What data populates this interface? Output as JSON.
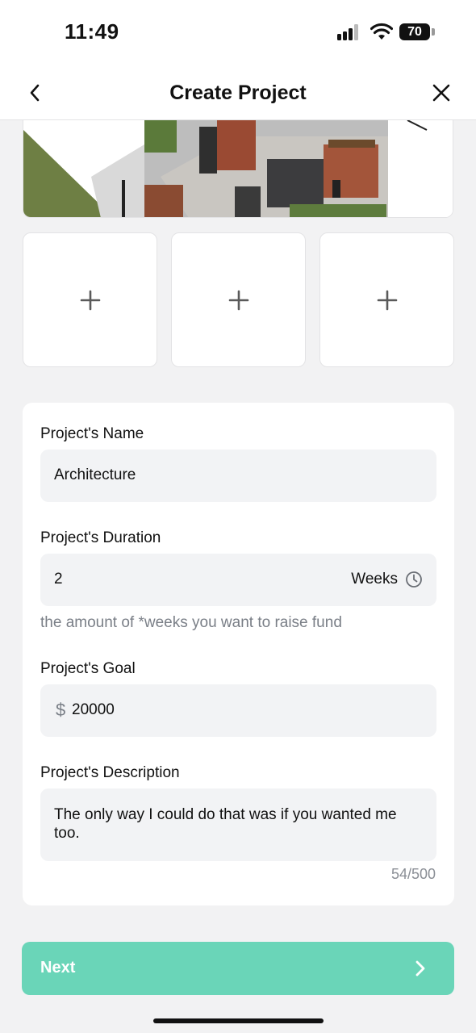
{
  "status_bar": {
    "time": "11:49",
    "battery": "70",
    "icons": [
      "signal-icon",
      "wifi-icon",
      "battery-icon"
    ]
  },
  "nav": {
    "title": "Create Project",
    "back_icon": "chevron-left-icon",
    "close_icon": "close-icon"
  },
  "photos": {
    "add_icon": "plus-icon",
    "slots": 3
  },
  "form": {
    "name": {
      "label": "Project's Name",
      "value": "Architecture"
    },
    "duration": {
      "label": "Project's Duration",
      "value": "2",
      "unit": "Weeks",
      "icon": "clock-icon",
      "helper": "the amount of *weeks you want to raise fund"
    },
    "goal": {
      "label": "Project's Goal",
      "currency": "$",
      "value": "20000"
    },
    "description": {
      "label": "Project's Description",
      "value": "The only way I could do that was if you wanted me too.",
      "counter": "54/500"
    }
  },
  "footer": {
    "next_label": "Next",
    "next_icon": "chevron-right-icon"
  },
  "colors": {
    "accent": "#6ad5b8",
    "page_bg": "#f2f2f3",
    "field_bg": "#f2f3f5",
    "helper_text": "#7a7f87"
  }
}
